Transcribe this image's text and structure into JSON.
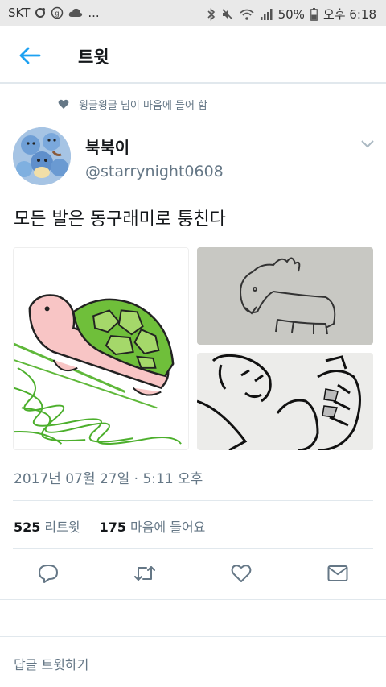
{
  "status_bar": {
    "carrier": "SKT",
    "battery": "50%",
    "time": "오후 6:18",
    "more": "...",
    "icons": [
      "circle-icon",
      "g-icon",
      "cloud-icon",
      "bluetooth-icon",
      "mute-icon",
      "wifi-icon",
      "signal-icon",
      "battery-icon"
    ]
  },
  "app_bar": {
    "back_icon": "arrow-left-icon",
    "title": "트윗"
  },
  "tweet": {
    "liked_by": "윙글윙글 님이 마음에 들어 함",
    "liked_icon": "heart-icon",
    "display_name": "북북이",
    "handle": "@starrynight0608",
    "text": "모든 발은 동구래미로 퉁친다",
    "timestamp": "2017년 07월 27일 · 5:11 오후",
    "stats": {
      "retweets_count": "525",
      "retweets_label": "리트윗",
      "likes_count": "175",
      "likes_label": "마음에 들어요"
    },
    "actions": [
      "reply-icon",
      "retweet-icon",
      "like-icon",
      "message-icon"
    ]
  },
  "reply_prompt": "답글 트윗하기",
  "colors": {
    "accent": "#1da1f2",
    "secondary_text": "#657786",
    "divider": "#e1e8ed",
    "status_bar_bg": "#e9e9e9"
  }
}
